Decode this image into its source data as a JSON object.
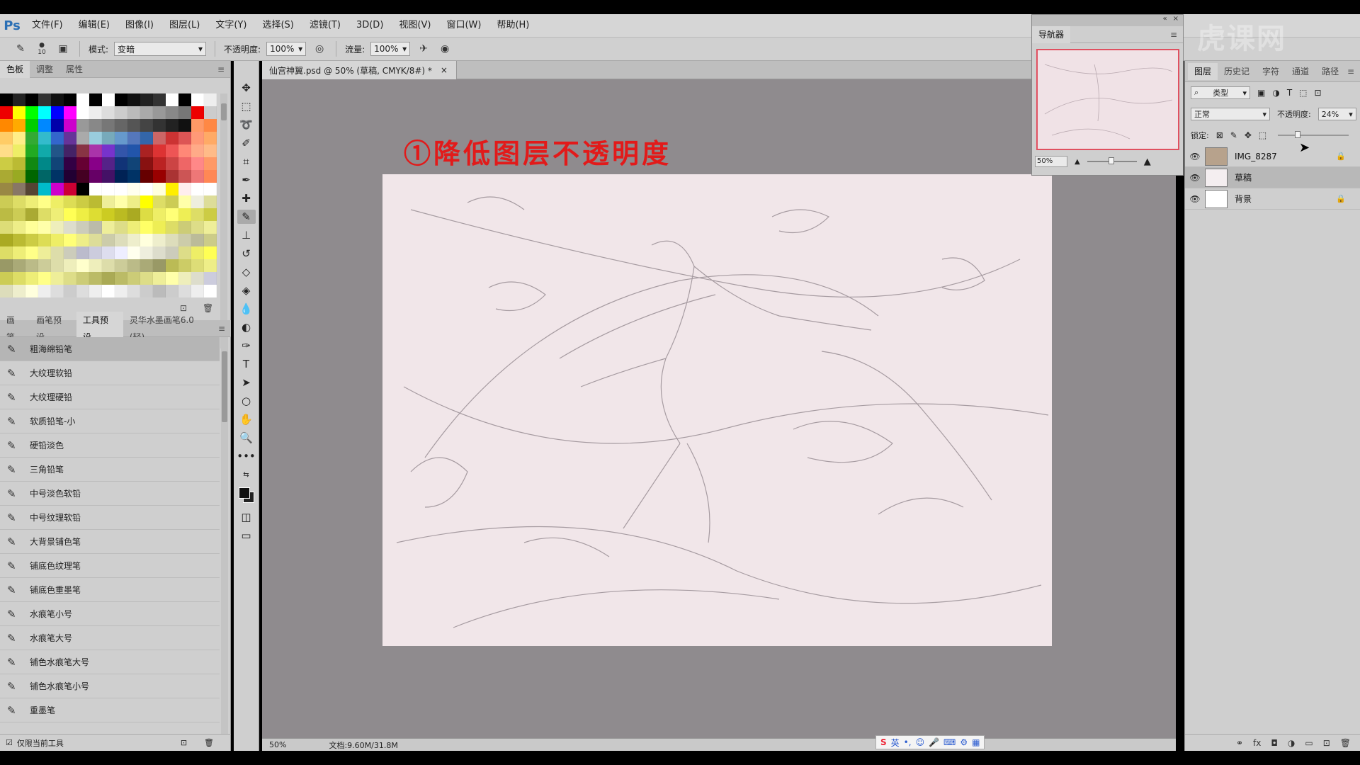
{
  "app": {
    "logo": "Ps"
  },
  "menu": [
    "文件(F)",
    "编辑(E)",
    "图像(I)",
    "图层(L)",
    "文字(Y)",
    "选择(S)",
    "滤镜(T)",
    "3D(D)",
    "视图(V)",
    "窗口(W)",
    "帮助(H)"
  ],
  "options": {
    "brush_size": "10",
    "mode_label": "模式:",
    "mode_value": "变暗",
    "opacity_label": "不透明度:",
    "opacity_value": "100%",
    "flow_label": "流量:",
    "flow_value": "100%"
  },
  "left_top_tabs": [
    "色板",
    "调整",
    "属性"
  ],
  "left_bottom_tabs": [
    "画笔",
    "画笔预设",
    "工具预设",
    "灵华水墨画笔6.0 (轻)"
  ],
  "presets": [
    "粗海绵铅笔",
    "大纹理软铅",
    "大纹理硬铅",
    "软质铅笔-小",
    "硬铅淡色",
    "三角铅笔",
    "中号淡色软铅",
    "中号纹理软铅",
    "大背景铺色笔",
    "铺底色纹理笔",
    "铺底色重墨笔",
    "水痕笔小号",
    "水痕笔大号",
    "铺色水痕笔大号",
    "铺色水痕笔小号",
    "重墨笔"
  ],
  "preset_footer": "仅限当前工具",
  "document": {
    "tab_title": "仙宫神翼.psd @ 50% (草稿, CMYK/8#) *",
    "annotation": "①降低图层不透明度",
    "zoom": "50%",
    "doc_info": "文档:9.60M/31.8M"
  },
  "navigator": {
    "title": "导航器",
    "zoom": "50%"
  },
  "layers_panel": {
    "tabs": [
      "图层",
      "历史记",
      "字符",
      "通道",
      "路径"
    ],
    "filter": "类型",
    "blend_mode": "正常",
    "opacity_label": "不透明度:",
    "opacity_value": "24%",
    "lock_label": "锁定:",
    "layers": [
      {
        "name": "IMG_8287",
        "locked": true,
        "selected": false
      },
      {
        "name": "草稿",
        "locked": false,
        "selected": true
      },
      {
        "name": "背景",
        "locked": true,
        "selected": false
      }
    ]
  },
  "ime_bar": {
    "lang": "英"
  },
  "watermark": "虎课网",
  "colors": {
    "annotation": "#e21a1a",
    "canvas": "#f1e6e9",
    "doc_bg": "#8f8b8e"
  }
}
